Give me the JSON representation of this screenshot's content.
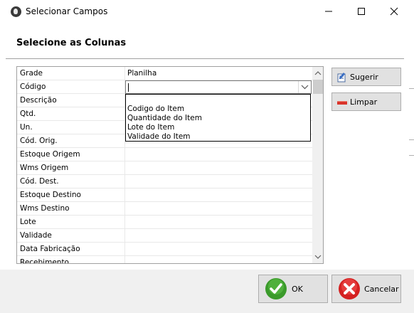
{
  "window": {
    "title": "Selecionar Campos"
  },
  "header": {
    "title": "Selecione as Colunas"
  },
  "grid": {
    "columns": [
      "Grade",
      "Planilha"
    ],
    "rows": [
      {
        "field": "Código",
        "value": ""
      },
      {
        "field": "Descrição",
        "value": ""
      },
      {
        "field": "Qtd.",
        "value": ""
      },
      {
        "field": "Un.",
        "value": ""
      },
      {
        "field": "Cód. Orig.",
        "value": ""
      },
      {
        "field": "Estoque Origem",
        "value": ""
      },
      {
        "field": "Wms Origem",
        "value": ""
      },
      {
        "field": "Cód. Dest.",
        "value": ""
      },
      {
        "field": "Estoque Destino",
        "value": ""
      },
      {
        "field": "Wms Destino",
        "value": ""
      },
      {
        "field": "Lote",
        "value": ""
      },
      {
        "field": "Validade",
        "value": ""
      },
      {
        "field": "Data Fabricação",
        "value": ""
      },
      {
        "field": "Recebimento",
        "value": ""
      }
    ]
  },
  "dropdown": {
    "options": [
      "",
      "Codigo do Item",
      "Quantidade do Item",
      "Lote do Item",
      "Validade do Item"
    ]
  },
  "buttons": {
    "suggest": "Sugerir",
    "clear": "Limpar",
    "ok": "OK",
    "cancel": "Cancelar"
  },
  "colors": {
    "ok_green": "#3a9a2a",
    "cancel_red": "#d42020",
    "clear_red": "#d9342b"
  }
}
